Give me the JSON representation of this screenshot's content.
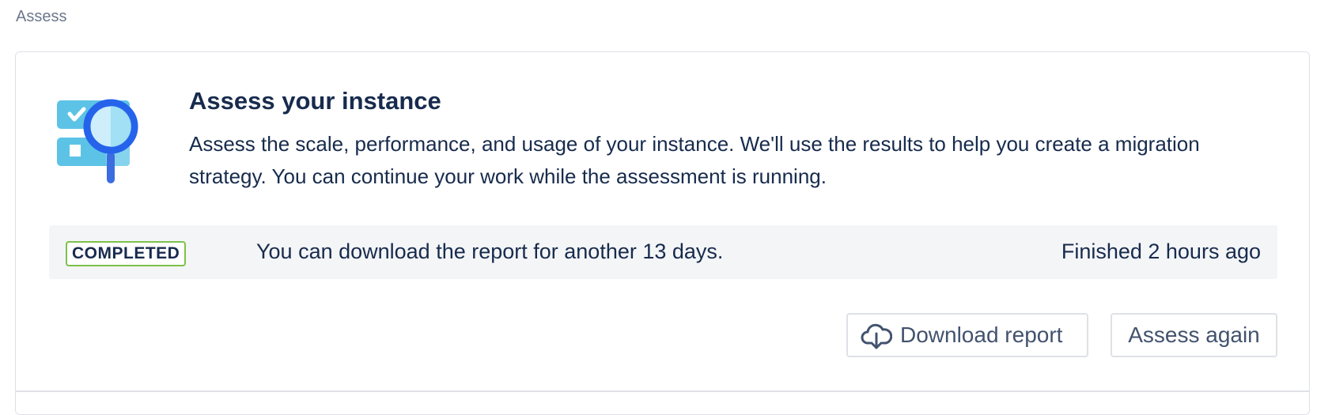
{
  "breadcrumb": {
    "label": "Assess"
  },
  "card": {
    "title": "Assess your instance",
    "description": "Assess the scale, performance, and usage of your instance. We'll use the results to help you create a migration strategy. You can continue your work while the assessment is running.",
    "illustration_icon": "assessment-magnifier-illustration"
  },
  "status": {
    "lozenge": "COMPLETED",
    "message": "You can download the report for another 13 days.",
    "finished": "Finished 2 hours ago"
  },
  "actions": {
    "download_label": "Download report",
    "download_icon": "cloud-download-icon",
    "assess_again_label": "Assess again"
  },
  "colors": {
    "primary_text": "#172b4d",
    "secondary_text": "#6b778c",
    "completed_border": "#7cc24a",
    "status_bg": "#f4f5f7",
    "magnifier": "#2563eb"
  }
}
